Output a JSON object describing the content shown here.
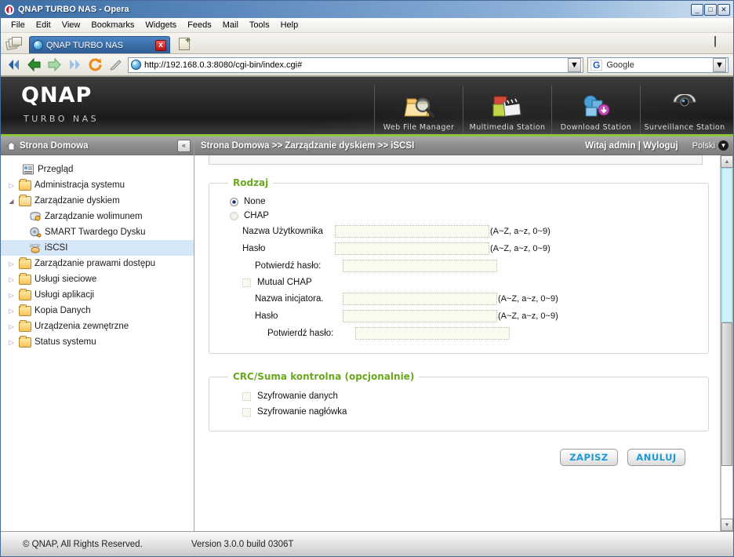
{
  "window": {
    "title": "QNAP TURBO NAS - Opera",
    "app_icon": "opera-icon",
    "minimize": "_",
    "maximize": "□",
    "close": "✕"
  },
  "menubar": {
    "items": [
      "File",
      "Edit",
      "View",
      "Bookmarks",
      "Widgets",
      "Feeds",
      "Mail",
      "Tools",
      "Help"
    ]
  },
  "tabbar": {
    "tab_label": "QNAP TURBO NAS",
    "close_label": "x",
    "new_tab_plus": "+"
  },
  "addressbar": {
    "url": "http://192.168.0.3:8080/cgi-bin/index.cgi#",
    "dropdown_caret": "▼",
    "search_engine": "Google",
    "search_engine_icon": "G",
    "search_caret": "▼"
  },
  "banner": {
    "logo": "QNAP",
    "tagline": "TURBO NAS",
    "apps": [
      {
        "label": "Web File Manager",
        "icon": "folder-magnifier-icon"
      },
      {
        "label": "Multimedia Station",
        "icon": "photos-clapperboard-icon"
      },
      {
        "label": "Download Station",
        "icon": "download-monitor-icon"
      },
      {
        "label": "Surveillance Station",
        "icon": "dome-camera-icon"
      }
    ]
  },
  "sidebar": {
    "header": "Strona Domowa",
    "header_icon": "home-icon",
    "collapse_label": "«",
    "items": [
      {
        "label": "Przegląd",
        "icon": "overview-icon",
        "level": 1,
        "expander": "",
        "selected": false
      },
      {
        "label": "Administracja systemu",
        "icon": "folder-icon",
        "level": 1,
        "expander": "▷",
        "selected": false
      },
      {
        "label": "Zarządzanie dyskiem",
        "icon": "folder-open-icon",
        "level": 1,
        "expander": "◢",
        "selected": false
      },
      {
        "label": "Zarządzanie wolimunem",
        "icon": "volume-icon",
        "level": 2,
        "expander": "",
        "selected": false
      },
      {
        "label": "SMART Twardego Dysku",
        "icon": "smart-disk-icon",
        "level": 2,
        "expander": "",
        "selected": false
      },
      {
        "label": "iSCSI",
        "icon": "iscsi-icon",
        "level": 2,
        "expander": "",
        "selected": true
      },
      {
        "label": "Zarządzanie prawami dostępu",
        "icon": "folder-icon",
        "level": 1,
        "expander": "▷",
        "selected": false
      },
      {
        "label": "Usługi sieciowe",
        "icon": "folder-icon",
        "level": 1,
        "expander": "▷",
        "selected": false
      },
      {
        "label": "Usługi aplikacji",
        "icon": "folder-icon",
        "level": 1,
        "expander": "▷",
        "selected": false
      },
      {
        "label": "Kopia Danych",
        "icon": "folder-icon",
        "level": 1,
        "expander": "▷",
        "selected": false
      },
      {
        "label": "Urządzenia zewnętrzne",
        "icon": "folder-icon",
        "level": 1,
        "expander": "▷",
        "selected": false
      },
      {
        "label": "Status systemu",
        "icon": "folder-icon",
        "level": 1,
        "expander": "▷",
        "selected": false
      }
    ]
  },
  "topbar": {
    "breadcrumb": "Strona Domowa >> Zarządzanie dyskiem >> iSCSI",
    "welcome": "Witaj admin | Wyloguj",
    "language": "Polski",
    "language_caret": "▼"
  },
  "form": {
    "type_section": {
      "title": "Rodzaj",
      "options": [
        {
          "label": "None",
          "selected": true
        },
        {
          "label": "CHAP",
          "selected": false
        }
      ],
      "fields": [
        {
          "label": "Nazwa Użytkownika",
          "value": "",
          "hint": "(A~Z, a~z, 0~9)",
          "disabled": true
        },
        {
          "label": "Hasło",
          "value": "",
          "hint": "(A~Z, a~z, 0~9)",
          "disabled": true
        },
        {
          "label": "Potwierdź hasło:",
          "value": "",
          "hint": "",
          "disabled": true
        }
      ],
      "mutual": {
        "label": "Mutual CHAP",
        "checked": false,
        "fields": [
          {
            "label": "Nazwa inicjatora.",
            "value": "",
            "hint": "(A~Z, a~z, 0~9)",
            "disabled": true
          },
          {
            "label": "Hasło",
            "value": "",
            "hint": "(A~Z, a~z, 0~9)",
            "disabled": true
          },
          {
            "label": "Potwierdź hasło:",
            "value": "",
            "hint": "",
            "disabled": true
          }
        ]
      }
    },
    "crc_section": {
      "title": "CRC/Suma kontrolna (opcjonalnie)",
      "checkboxes": [
        {
          "label": "Szyfrowanie danych",
          "checked": false
        },
        {
          "label": "Szyfrowanie nagłówka",
          "checked": false
        }
      ]
    },
    "buttons": {
      "save": "ZAPISZ",
      "cancel": "ANULUJ"
    }
  },
  "scrollbar": {
    "up_arrow": "▲",
    "down_arrow": "▼"
  },
  "footer": {
    "copyright": "© QNAP, All Rights Reserved.",
    "version": "Version 3.0.0 build 0306T"
  },
  "colors": {
    "accent_green": "#8dc63f",
    "legend_green": "#6aa81e",
    "button_blue": "#1e9ad6",
    "selection_blue": "#d6e7f8"
  }
}
